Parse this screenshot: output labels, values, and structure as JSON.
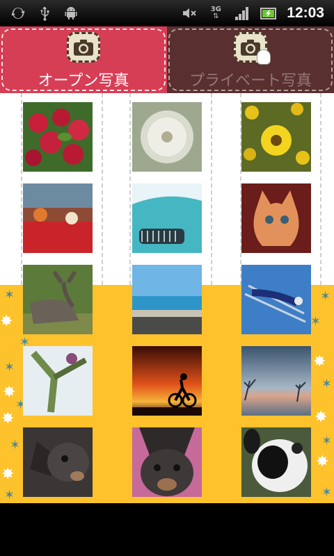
{
  "statusbar": {
    "time": "12:03",
    "network_label": "3G",
    "left_icons": [
      "sync-icon",
      "usb-icon",
      "android-icon"
    ],
    "right_icons": [
      "mute-icon",
      "network-3g-icon",
      "signal-icon",
      "battery-charging-icon"
    ]
  },
  "tabs": [
    {
      "label": "オープン写真",
      "icon": "camera-icon",
      "selected": true
    },
    {
      "label": "プライベート写真",
      "icon": "private-camera-icon",
      "selected": false
    }
  ],
  "colors": {
    "tab_selected": "#d63e55",
    "tab_unselected": "#5a2f2f",
    "background_top": "#ffffff",
    "background_bottom": "#fec22c"
  },
  "photos": [
    {
      "name": "photo-apples"
    },
    {
      "name": "photo-dandelion"
    },
    {
      "name": "photo-sunflowers"
    },
    {
      "name": "photo-market-produce"
    },
    {
      "name": "photo-vintage-car"
    },
    {
      "name": "photo-kitten"
    },
    {
      "name": "photo-moose"
    },
    {
      "name": "photo-beach"
    },
    {
      "name": "photo-ski-jumper"
    },
    {
      "name": "photo-snow-angel"
    },
    {
      "name": "photo-cyclist-sunset"
    },
    {
      "name": "photo-winter-field"
    },
    {
      "name": "photo-dog-closeup-1"
    },
    {
      "name": "photo-dog-closeup-2"
    },
    {
      "name": "photo-dog-plush"
    }
  ]
}
